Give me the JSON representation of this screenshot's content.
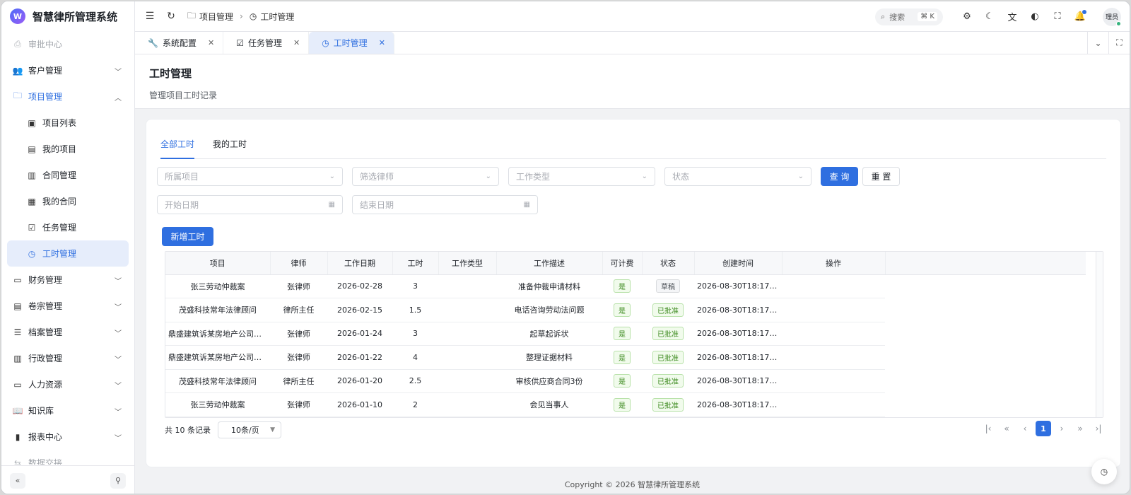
{
  "app": {
    "title": "智慧律所管理系统",
    "logo_letter": "W"
  },
  "sidebar": {
    "items": [
      {
        "label": "审批中心",
        "icon": "approval-icon",
        "glyph": "⎙",
        "state": "faded"
      },
      {
        "label": "客户管理",
        "icon": "users-icon",
        "glyph": "👥",
        "state": "collapsed"
      },
      {
        "label": "项目管理",
        "icon": "folder-icon",
        "glyph": "🗀",
        "state": "open"
      },
      {
        "label": "项目列表",
        "icon": "briefcase-icon",
        "glyph": "▣",
        "state": "sub"
      },
      {
        "label": "我的项目",
        "icon": "clipboard-icon",
        "glyph": "▤",
        "state": "sub"
      },
      {
        "label": "合同管理",
        "icon": "contract-icon",
        "glyph": "▥",
        "state": "sub"
      },
      {
        "label": "我的合同",
        "icon": "document-icon",
        "glyph": "▦",
        "state": "sub"
      },
      {
        "label": "任务管理",
        "icon": "checkbox-icon",
        "glyph": "☑",
        "state": "sub"
      },
      {
        "label": "工时管理",
        "icon": "clock-icon",
        "glyph": "◷",
        "state": "active"
      },
      {
        "label": "财务管理",
        "icon": "wallet-icon",
        "glyph": "▭",
        "state": "collapsed"
      },
      {
        "label": "卷宗管理",
        "icon": "file-icon",
        "glyph": "▤",
        "state": "collapsed"
      },
      {
        "label": "档案管理",
        "icon": "database-icon",
        "glyph": "☰",
        "state": "collapsed"
      },
      {
        "label": "行政管理",
        "icon": "building-icon",
        "glyph": "▥",
        "state": "collapsed"
      },
      {
        "label": "人力资源",
        "icon": "id-card-icon",
        "glyph": "▭",
        "state": "collapsed"
      },
      {
        "label": "知识库",
        "icon": "book-icon",
        "glyph": "📖",
        "state": "collapsed"
      },
      {
        "label": "报表中心",
        "icon": "bar-chart-icon",
        "glyph": "▮",
        "state": "collapsed"
      },
      {
        "label": "数据交接",
        "icon": "transfer-icon",
        "glyph": "⇆",
        "state": "faded"
      }
    ]
  },
  "header": {
    "breadcrumb": [
      "项目管理",
      "工时管理"
    ],
    "search_label": "搜索",
    "search_shortcut": "⌘ K",
    "avatar_text": "理员"
  },
  "tabs": [
    {
      "label": "系统配置",
      "icon": "wrench-icon",
      "glyph": "🔧",
      "active": false
    },
    {
      "label": "任务管理",
      "icon": "checkbox-icon",
      "glyph": "☑",
      "active": false
    },
    {
      "label": "工时管理",
      "icon": "clock-icon",
      "glyph": "◷",
      "active": true
    }
  ],
  "page": {
    "title": "工时管理",
    "subtitle": "管理项目工时记录"
  },
  "subtabs": [
    "全部工时",
    "我的工时"
  ],
  "filters": {
    "project_placeholder": "所属项目",
    "lawyer_placeholder": "筛选律师",
    "worktype_placeholder": "工作类型",
    "status_placeholder": "状态",
    "start_placeholder": "开始日期",
    "end_placeholder": "结束日期",
    "query_label": "查 询",
    "reset_label": "重 置"
  },
  "add_label": "新增工时",
  "table": {
    "headers": [
      "项目",
      "律师",
      "工作日期",
      "工时",
      "工作类型",
      "工作描述",
      "可计费",
      "状态",
      "创建时间",
      "操作"
    ],
    "rows": [
      {
        "project": "张三劳动仲裁案",
        "lawyer": "张律师",
        "date": "2026-02-28",
        "hours": "3",
        "type": "",
        "desc": "准备仲裁申请材料",
        "billable": "是",
        "status": "草稿",
        "draft": true,
        "created": "2026-08-30T18:17:0...",
        "ops": ""
      },
      {
        "project": "茂盛科技常年法律顾问",
        "lawyer": "律所主任",
        "date": "2026-02-15",
        "hours": "1.5",
        "type": "",
        "desc": "电话咨询劳动法问题",
        "billable": "是",
        "status": "已批准",
        "draft": false,
        "created": "2026-08-30T18:17:0...",
        "ops": ""
      },
      {
        "project": "鼎盛建筑诉某房地产公司工程...",
        "lawyer": "张律师",
        "date": "2026-01-24",
        "hours": "3",
        "type": "",
        "desc": "起草起诉状",
        "billable": "是",
        "status": "已批准",
        "draft": false,
        "created": "2026-08-30T18:17:0...",
        "ops": ""
      },
      {
        "project": "鼎盛建筑诉某房地产公司工程...",
        "lawyer": "张律师",
        "date": "2026-01-22",
        "hours": "4",
        "type": "",
        "desc": "整理证据材料",
        "billable": "是",
        "status": "已批准",
        "draft": false,
        "created": "2026-08-30T18:17:0...",
        "ops": ""
      },
      {
        "project": "茂盛科技常年法律顾问",
        "lawyer": "律所主任",
        "date": "2026-01-20",
        "hours": "2.5",
        "type": "",
        "desc": "审核供应商合同3份",
        "billable": "是",
        "status": "已批准",
        "draft": false,
        "created": "2026-08-30T18:17:0...",
        "ops": ""
      },
      {
        "project": "张三劳动仲裁案",
        "lawyer": "张律师",
        "date": "2026-01-10",
        "hours": "2",
        "type": "",
        "desc": "会见当事人",
        "billable": "是",
        "status": "已批准",
        "draft": false,
        "created": "2026-08-30T18:17:0...",
        "ops": ""
      }
    ]
  },
  "pagination": {
    "total_text": "共 10 条记录",
    "page_size": "10条/页",
    "current_page": "1"
  },
  "footer": "Copyright © 2026  智慧律所管理系统",
  "colors": {
    "accent": "#2f6fe0",
    "success": "#3c8a1e",
    "active_bg": "#e6edfb"
  }
}
